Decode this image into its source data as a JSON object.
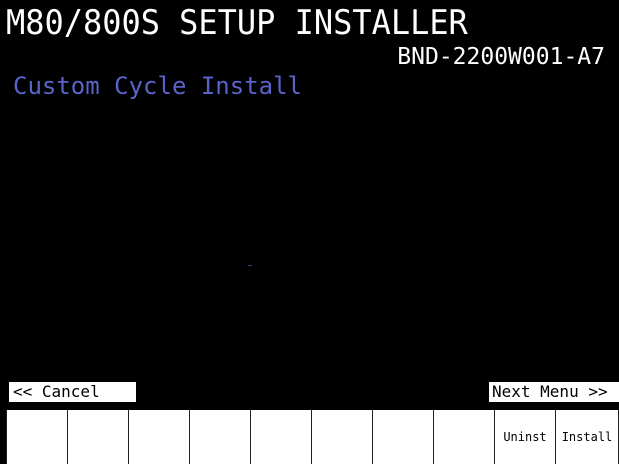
{
  "header": {
    "title": "M80/800S SETUP INSTALLER",
    "version": "BND-2200W001-A7",
    "subtitle": "Custom Cycle Install"
  },
  "navigation": {
    "cancel_label": "<< Cancel",
    "next_label": "Next Menu >>"
  },
  "function_keys": [
    "",
    "",
    "",
    "",
    "",
    "",
    "",
    "",
    "Uninst",
    "Install"
  ],
  "colors": {
    "background": "#000000",
    "title_text": "#ffffff",
    "subtitle_text": "#5a64c8",
    "button_background": "#ffffff"
  }
}
